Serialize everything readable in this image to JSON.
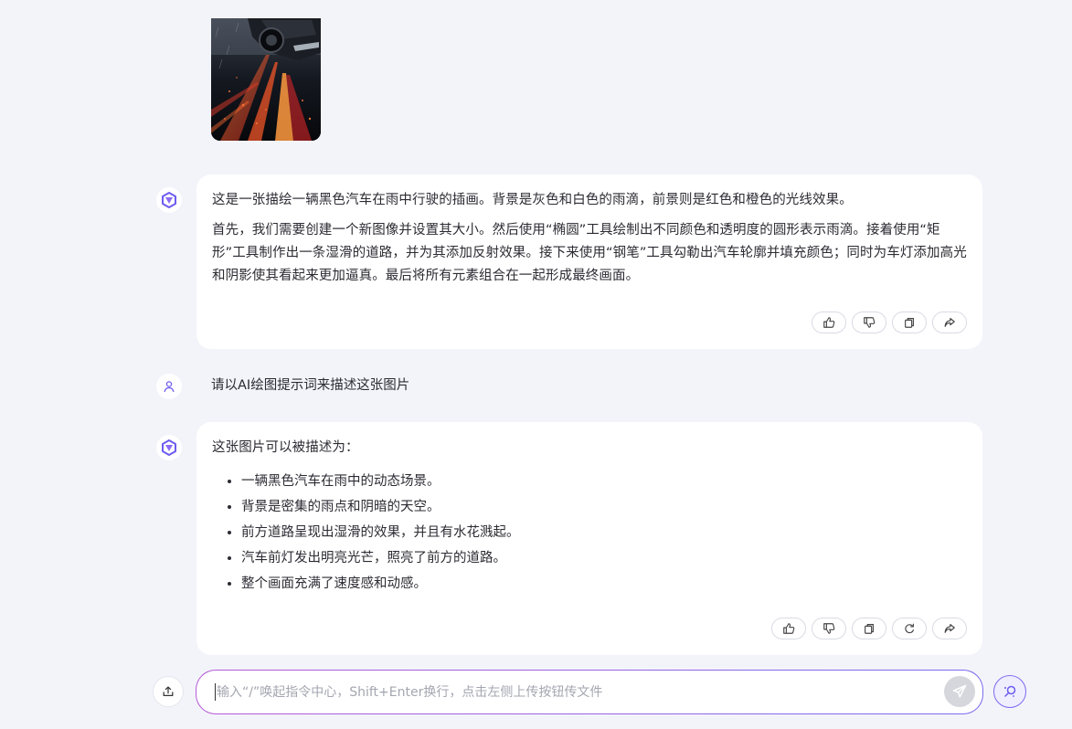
{
  "conversation": {
    "image_message": {
      "alt": "black car driving in rain illustration"
    },
    "assistant_1": {
      "paragraphs": [
        "这是一张描绘一辆黑色汽车在雨中行驶的插画。背景是灰色和白色的雨滴，前景则是红色和橙色的光线效果。",
        "首先，我们需要创建一个新图像并设置其大小。然后使用“椭圆”工具绘制出不同颜色和透明度的圆形表示雨滴。接着使用“矩形”工具制作出一条湿滑的道路，并为其添加反射效果。接下来使用“钢笔”工具勾勒出汽车轮廓并填充颜色；同时为车灯添加高光和阴影使其看起来更加逼真。最后将所有元素组合在一起形成最终画面。"
      ],
      "actions": [
        "thumbs-up-icon",
        "thumbs-down-icon",
        "copy-icon",
        "share-icon"
      ]
    },
    "user_1": {
      "text": "请以AI绘图提示词来描述这张图片"
    },
    "assistant_2": {
      "intro": "这张图片可以被描述为：",
      "bullets": [
        "一辆黑色汽车在雨中的动态场景。",
        "背景是密集的雨点和阴暗的天空。",
        "前方道路呈现出湿滑的效果，并且有水花溅起。",
        "汽车前灯发出明亮光芒，照亮了前方的道路。",
        "整个画面充满了速度感和动感。"
      ],
      "actions": [
        "thumbs-up-icon",
        "thumbs-down-icon",
        "copy-icon",
        "regenerate-icon",
        "share-icon"
      ]
    }
  },
  "composer": {
    "placeholder": "输入“/”唤起指令中心，Shift+Enter换行，点击左侧上传按钮传文件",
    "value": ""
  },
  "colors": {
    "background": "#f3f4f9",
    "accent": "#6d5cf0",
    "composer_border_start": "#b65bd8",
    "composer_border_end": "#7a6cf0",
    "send_disabled": "#d6d7dd"
  }
}
